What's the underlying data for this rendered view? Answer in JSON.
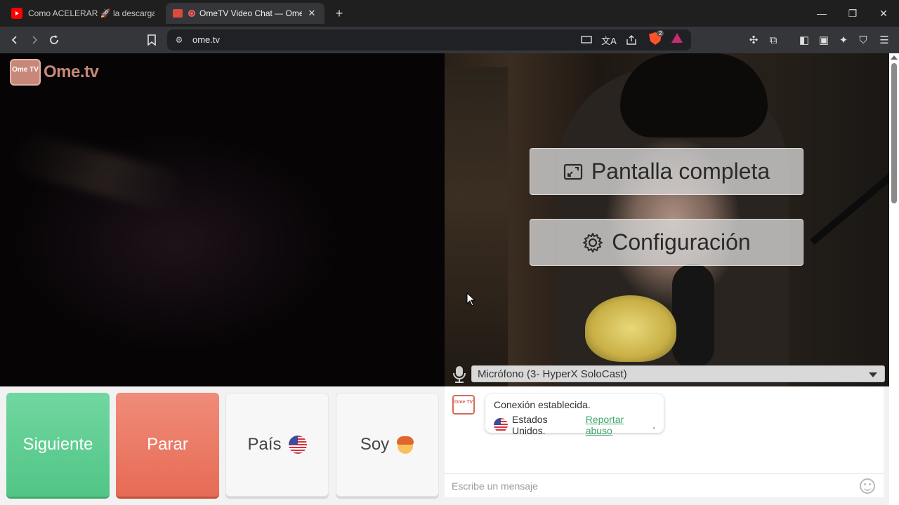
{
  "browser": {
    "tabs": [
      {
        "title": "Como ACELERAR 🚀 la descarga de l",
        "favicon": "youtube-icon"
      },
      {
        "title": "OmeTV Video Chat — Omegle",
        "favicon": "ometv-icon"
      }
    ],
    "address": "ome.tv",
    "shield_count": "2"
  },
  "site": {
    "logo_badge": "Ome TV",
    "logo_text": "Ome.tv"
  },
  "overlay": {
    "fullscreen_label": "Pantalla completa",
    "settings_label": "Configuración"
  },
  "microphone": {
    "selected": "Micrófono (3- HyperX SoloCast)"
  },
  "controls": {
    "next_label": "Siguiente",
    "stop_label": "Parar",
    "country_label": "País",
    "gender_label": "Soy"
  },
  "chat": {
    "logo_badge": "Ome TV",
    "status": "Conexión establecida.",
    "country": "Estados Unidos.",
    "report_link": "Reportar abuso",
    "report_suffix": ".",
    "input_placeholder": "Escribe un mensaje"
  },
  "colors": {
    "next": "#52c586",
    "stop": "#e76b55",
    "link": "#3fa66b"
  }
}
